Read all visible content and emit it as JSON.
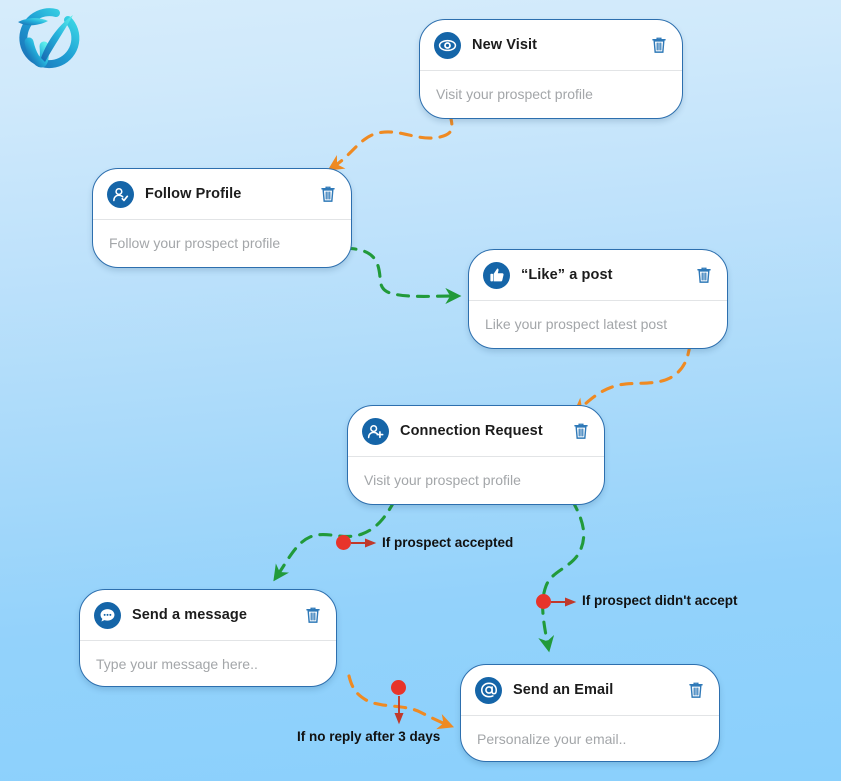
{
  "app": {
    "logo_name": "brand-checkmark-logo",
    "background_top_color": "#d6ecfb",
    "background_bottom_color": "#8ad0fc"
  },
  "colors": {
    "card_border": "#2d6fae",
    "icon_circle": "#1565a8",
    "trash_icon": "#2f79b8",
    "placeholder_text": "#a3a6a9",
    "title_text": "#1c1c1c",
    "edge_orange": "#ef8a22",
    "edge_green": "#219a3a",
    "condition_dot": "#e8342a",
    "condition_arrow": "#c0392b"
  },
  "nodes": [
    {
      "id": "new-visit",
      "icon": "eye-icon",
      "title": "New Visit",
      "placeholder": "Visit your prospect profile",
      "delete_label": "trash-icon"
    },
    {
      "id": "follow-profile",
      "icon": "user-check-icon",
      "title": "Follow Profile",
      "placeholder": "Follow your prospect profile",
      "delete_label": "trash-icon"
    },
    {
      "id": "like-a-post",
      "icon": "thumbs-up-icon",
      "title": "“Like” a post",
      "placeholder": "Like your prospect latest post",
      "delete_label": "trash-icon"
    },
    {
      "id": "connection-request",
      "icon": "user-plus-icon",
      "title": "Connection Request",
      "placeholder": "Visit your prospect profile",
      "delete_label": "trash-icon"
    },
    {
      "id": "send-a-message",
      "icon": "chat-bubble-icon",
      "title": "Send a message",
      "placeholder": "Type your message here..",
      "delete_label": "trash-icon"
    },
    {
      "id": "send-an-email",
      "icon": "at-sign-icon",
      "title": "Send an Email",
      "placeholder": "Personalize your email..",
      "delete_label": "trash-icon"
    }
  ],
  "conditions": [
    {
      "id": "prospect-accepted",
      "label": "If prospect accepted"
    },
    {
      "id": "prospect-didnt-accept",
      "label": "If prospect didn't accept"
    },
    {
      "id": "no-reply-3-days",
      "label": "If no reply after 3 days"
    }
  ],
  "edges": [
    {
      "from": "new-visit",
      "to": "follow-profile",
      "style": "dashed",
      "color": "orange"
    },
    {
      "from": "follow-profile",
      "to": "like-a-post",
      "style": "dashed",
      "color": "green"
    },
    {
      "from": "like-a-post",
      "to": "connection-request",
      "style": "dashed",
      "color": "orange"
    },
    {
      "from": "connection-request",
      "to": "send-a-message",
      "style": "dashed",
      "color": "green",
      "condition": "prospect-accepted"
    },
    {
      "from": "connection-request",
      "to": "send-an-email",
      "style": "dashed",
      "color": "green",
      "condition": "prospect-didnt-accept"
    },
    {
      "from": "send-a-message",
      "to": "send-an-email",
      "style": "dashed",
      "color": "orange",
      "condition": "no-reply-3-days"
    }
  ]
}
